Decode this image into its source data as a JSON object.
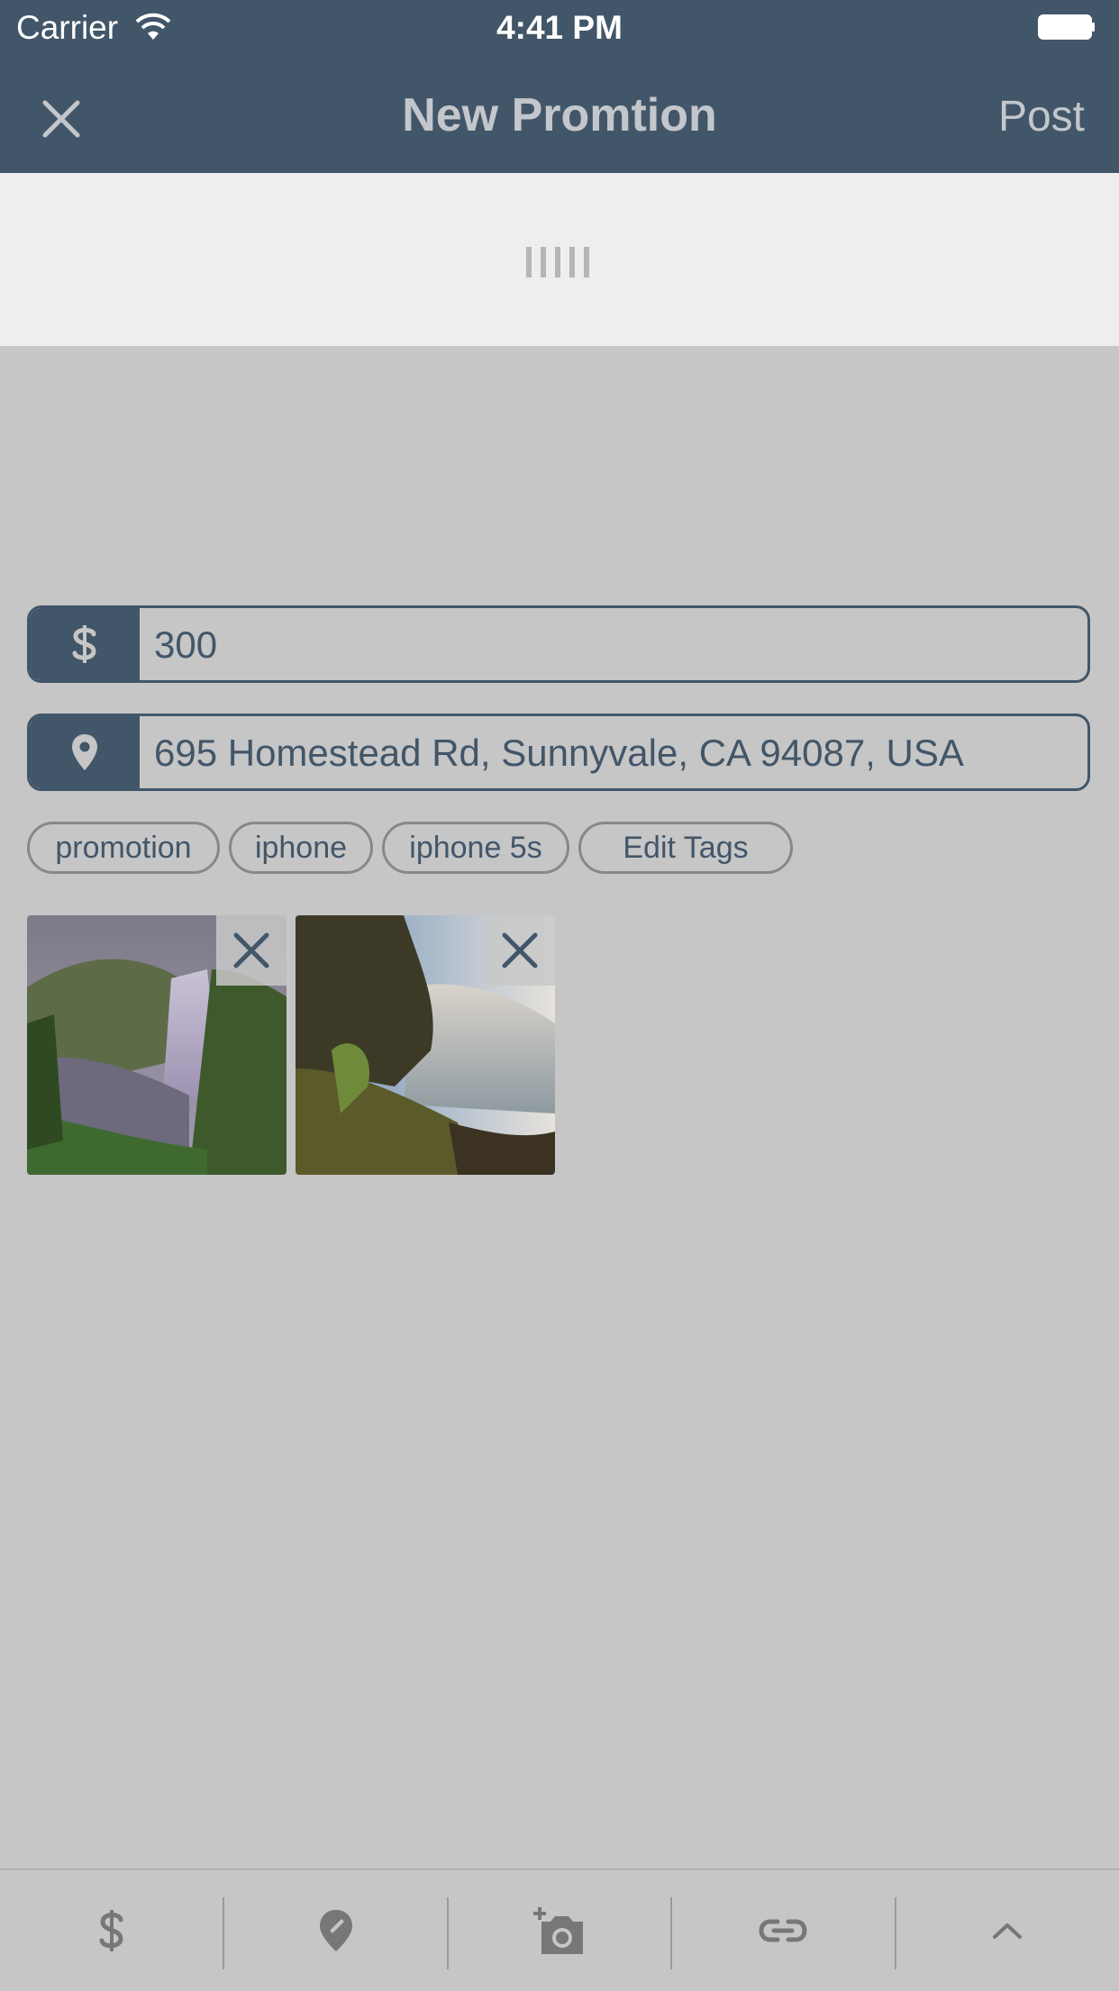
{
  "status_bar": {
    "carrier": "Carrier",
    "time": "4:41 PM"
  },
  "nav": {
    "title": "New Promtion",
    "post_label": "Post",
    "close_icon": "close-icon"
  },
  "form": {
    "price": {
      "icon": "dollar-icon",
      "value": "300"
    },
    "location": {
      "icon": "location-pin-icon",
      "value": "695 Homestead Rd, Sunnyvale, CA 94087, USA"
    }
  },
  "tags": [
    "promotion",
    "iphone",
    "iphone 5s"
  ],
  "edit_tags_label": "Edit Tags",
  "photos": [
    {
      "subject": "waterfall with misty valley",
      "remove_icon": "close-icon"
    },
    {
      "subject": "waterfall with mossy rocks",
      "remove_icon": "close-icon"
    }
  ],
  "toolbar": {
    "items": [
      "dollar-icon",
      "location-pin-icon",
      "add-photo-icon",
      "link-icon",
      "chevron-up-icon"
    ]
  },
  "colors": {
    "nav_bg": "#425669",
    "overlay_bg": "#c6c6c6",
    "handle_bg": "#eeeeee",
    "accent": "#425669"
  }
}
